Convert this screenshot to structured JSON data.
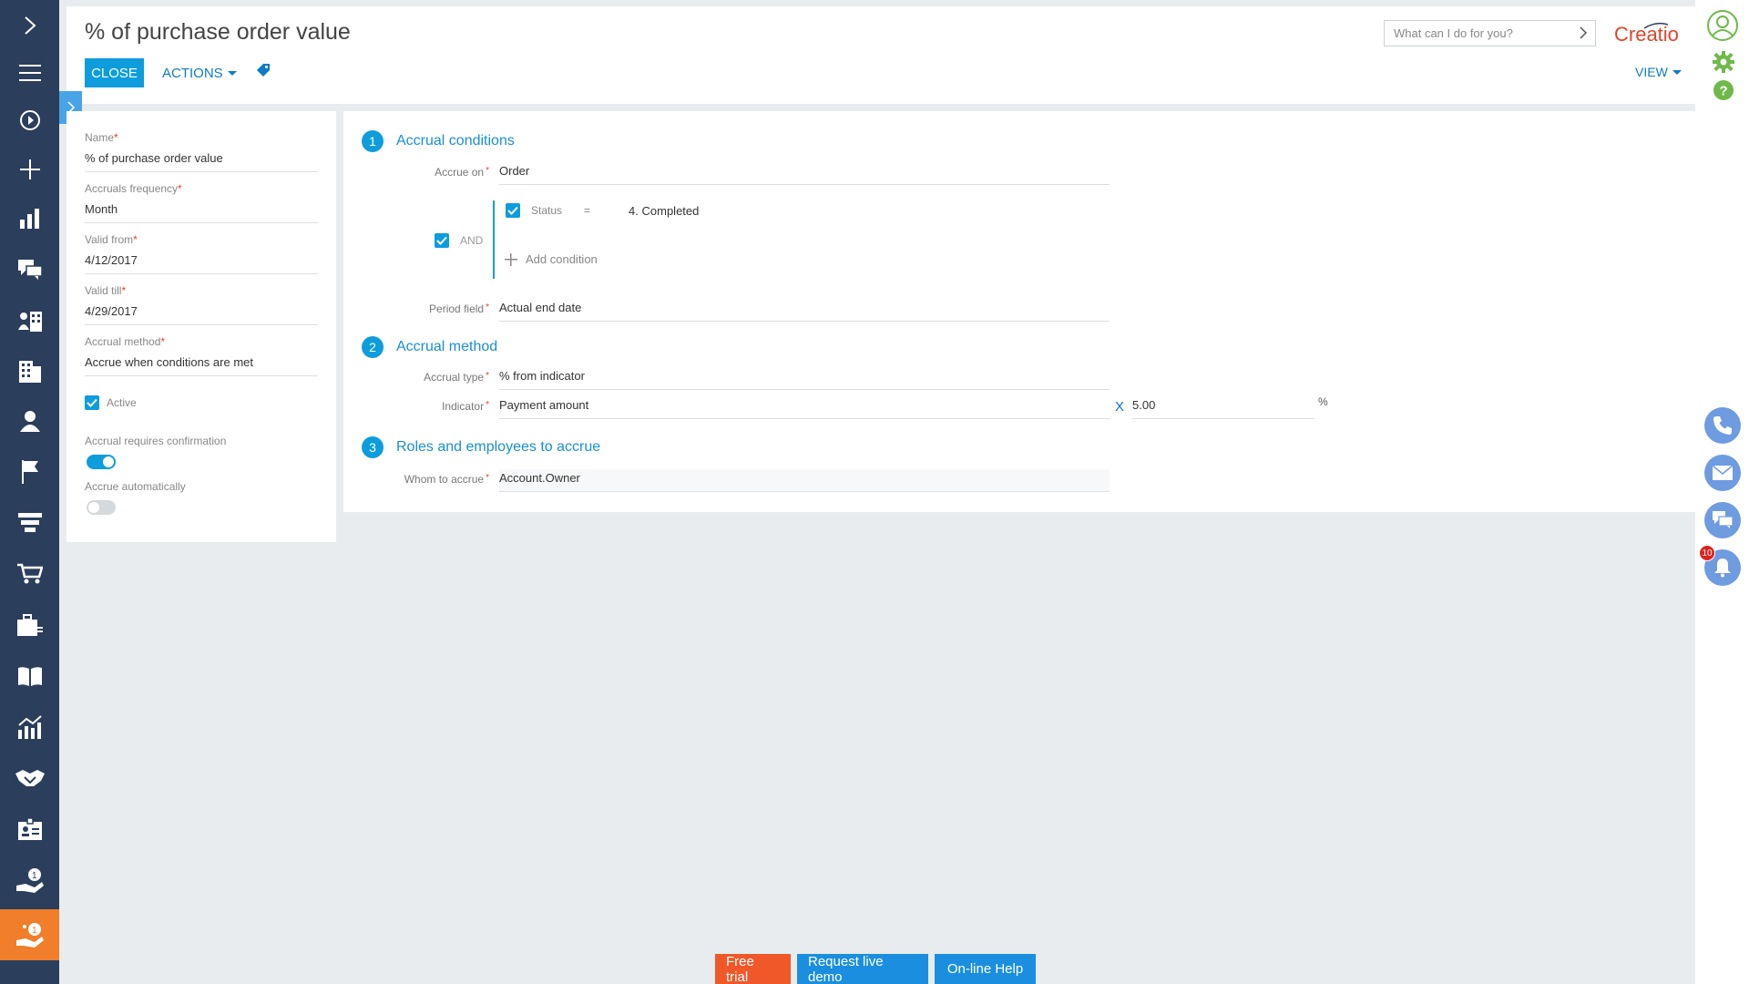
{
  "header": {
    "title": "% of purchase order value",
    "close_label": "CLOSE",
    "actions_label": "ACTIONS",
    "view_label": "VIEW",
    "search_placeholder": "What can I do for you?",
    "logo_text": "Creatio"
  },
  "left_nav": {
    "icons": [
      "expand-icon",
      "menu-icon",
      "play-icon",
      "plus-icon",
      "dashboards-icon",
      "feed-icon",
      "contacts-org-icon",
      "accounts-icon",
      "contact-icon",
      "leads-icon",
      "funnel-icon",
      "orders-icon",
      "portfolio-icon",
      "knowledge-icon",
      "analytics-icon",
      "partners-icon",
      "id-card-icon",
      "loyalty-icon",
      "accruals-icon"
    ],
    "active": "accruals-icon"
  },
  "left_panel": {
    "name": {
      "label": "Name",
      "value": "% of purchase order value"
    },
    "frequency": {
      "label": "Accruals frequency",
      "value": "Month"
    },
    "valid_from": {
      "label": "Valid from",
      "value": "4/12/2017"
    },
    "valid_till": {
      "label": "Valid till",
      "value": "4/29/2017"
    },
    "method": {
      "label": "Accrual method",
      "value": "Accrue when conditions are met"
    },
    "active": {
      "label": "Active",
      "checked": true
    },
    "requires_confirmation": {
      "label": "Accrual requires confirmation",
      "on": true
    },
    "accrue_automatically": {
      "label": "Accrue automatically",
      "on": false
    }
  },
  "sections": {
    "s1": {
      "num": "1",
      "title": "Accrual conditions",
      "accrue_on_label": "Accrue on",
      "accrue_on_value": "Order",
      "and_label": "AND",
      "status_label": "Status",
      "status_op": "=",
      "status_value": "4. Completed",
      "add_condition": "Add condition",
      "period_label": "Period field",
      "period_value": "Actual end date"
    },
    "s2": {
      "num": "2",
      "title": "Accrual method",
      "type_label": "Accrual type",
      "type_value": "% from indicator",
      "indicator_label": "Indicator",
      "indicator_value": "Payment amount",
      "multiply": "X",
      "factor": "5.00",
      "percent": "%"
    },
    "s3": {
      "num": "3",
      "title": "Roles and employees to accrue",
      "whom_label": "Whom to accrue",
      "whom_value": "Account.Owner"
    }
  },
  "right_rail": {
    "notification_count": "10"
  },
  "bottom": {
    "free_trial": "Free trial",
    "demo": "Request live demo",
    "help": "On-line Help"
  },
  "colors": {
    "nav_bg": "#2b3e5b",
    "accent": "#0d9ddc",
    "active_nav": "#f07e2a",
    "required": "#e0442c"
  }
}
